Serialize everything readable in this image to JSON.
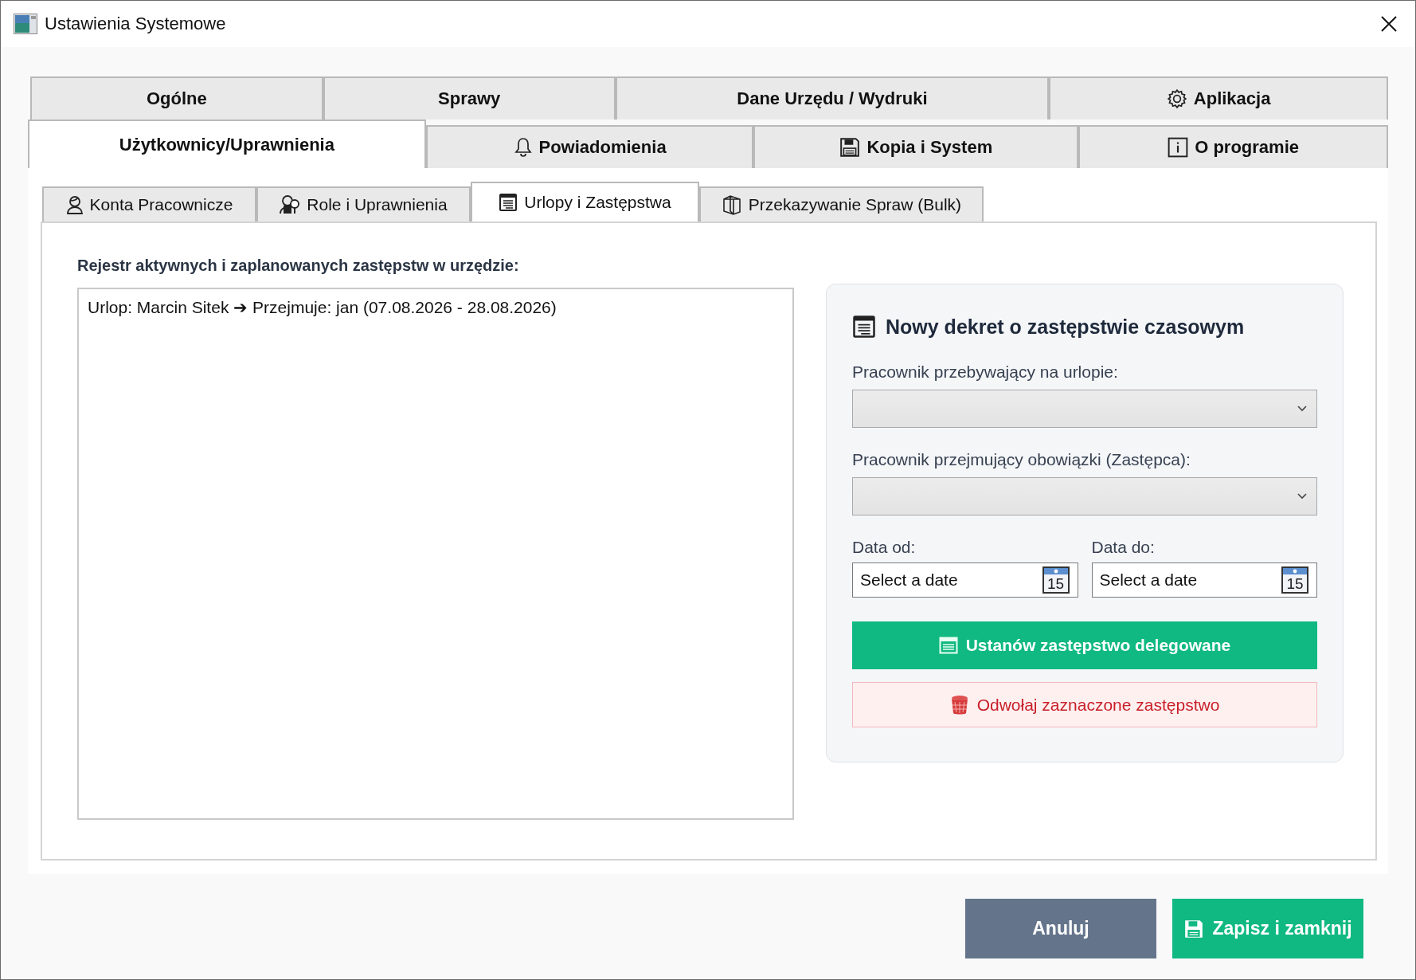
{
  "window": {
    "title": "Ustawienia Systemowe"
  },
  "tab_rows": [
    {
      "tabs": [
        {
          "label": "Ogólne",
          "selected": false
        },
        {
          "label": "Sprawy",
          "selected": false
        },
        {
          "label": "Dane Urzędu / Wydruki",
          "selected": false
        },
        {
          "label": "Aplikacja",
          "selected": false
        }
      ]
    },
    {
      "tabs": [
        {
          "label": "Użytkownicy/Uprawnienia",
          "selected": true
        },
        {
          "label": "Powiadomienia",
          "selected": false
        },
        {
          "label": "Kopia i System",
          "selected": false
        },
        {
          "label": "O programie",
          "selected": false
        }
      ]
    }
  ],
  "subtabs": [
    {
      "label": "Konta Pracownicze",
      "selected": false
    },
    {
      "label": "Role i Uprawnienia",
      "selected": false
    },
    {
      "label": "Urlopy i Zastępstwa",
      "selected": true
    },
    {
      "label": "Przekazywanie Spraw (Bulk)",
      "selected": false
    }
  ],
  "register": {
    "label": "Rejestr aktywnych i zaplanowanych zastępstw w urzędzie:",
    "items": [
      {
        "text": "Urlop: Marcin Sitek ➔ Przejmuje: jan (07.08.2026 - 28.08.2026)"
      }
    ]
  },
  "form": {
    "title": "Nowy dekret o zastępstwie czasowym",
    "absent_employee": {
      "label": "Pracownik przebywający na urlopie:"
    },
    "substitute": {
      "label": "Pracownik przejmujący obowiązki (Zastępca):"
    },
    "date_from": {
      "label": "Data od:",
      "placeholder": "Select a date",
      "calendar_day": "15"
    },
    "date_to": {
      "label": "Data do:",
      "placeholder": "Select a date",
      "calendar_day": "15"
    },
    "buttons": [
      {
        "label": "Ustanów zastępstwo delegowane",
        "kind": "primary"
      },
      {
        "label": "Odwołaj zaznaczone zastępstwo",
        "kind": "danger"
      }
    ]
  },
  "footer_buttons": [
    {
      "label": "Anuluj",
      "kind": "secondary"
    },
    {
      "label": "Zapisz i zamknij",
      "kind": "primary"
    }
  ]
}
